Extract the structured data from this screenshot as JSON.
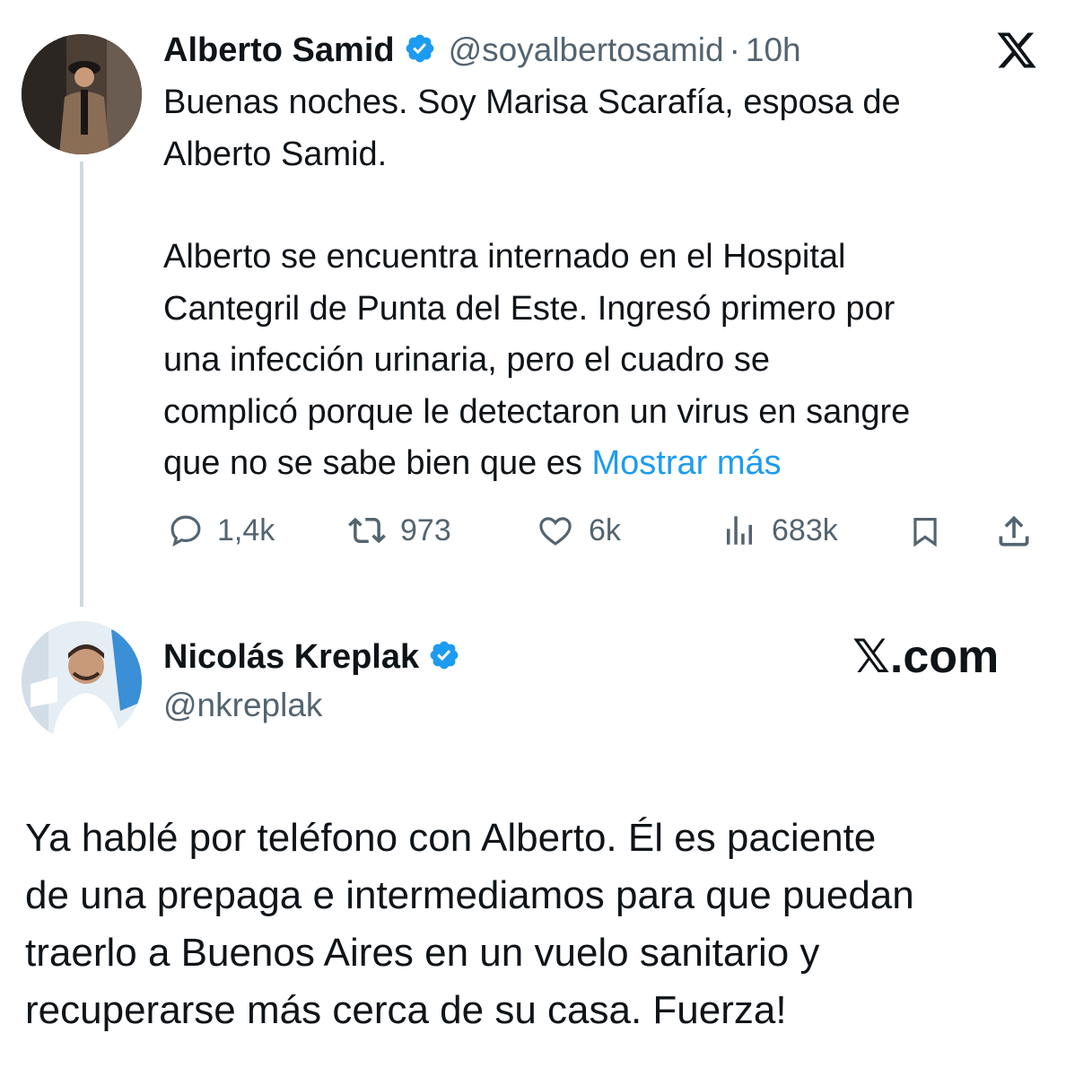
{
  "tweet1": {
    "name": "Alberto Samid",
    "handle": "@soyalbertosamid",
    "separator": "·",
    "time": "10h",
    "line1": "Buenas noches. Soy Marisa Scarafía, esposa de",
    "line2": "Alberto Samid.",
    "para2_l1": "Alberto se encuentra internado en el Hospital",
    "para2_l2": "Cantegril de Punta del Este. Ingresó primero por",
    "para2_l3": "una infección urinaria,  pero el cuadro se",
    "para2_l4": "complicó porque le detectaron un virus en sangre",
    "para2_l5": "que no se sabe bien que es",
    "show_more": "Mostrar más",
    "replies": "1,4k",
    "retweets": "973",
    "likes": "6k",
    "views": "683k"
  },
  "tweet2": {
    "name": "Nicolás Kreplak",
    "handle": "@nkreplak",
    "watermark": "𝕏.com",
    "line1": "Ya hablé por teléfono con Alberto. Él es paciente",
    "line2": "de una prepaga e intermediamos para que puedan",
    "line3": "traerlo a Buenos Aires en un vuelo sanitario y",
    "line4": "recuperarse más cerca de su casa. Fuerza!"
  },
  "icons": {
    "x_logo": "x-logo-icon",
    "verified": "verified-badge-icon",
    "reply": "reply-icon",
    "retweet": "retweet-icon",
    "like": "heart-icon",
    "views": "views-icon",
    "bookmark": "bookmark-icon",
    "share": "share-icon"
  },
  "colors": {
    "accent": "#1d9bf0",
    "muted": "#536471",
    "text": "#0f1419"
  }
}
